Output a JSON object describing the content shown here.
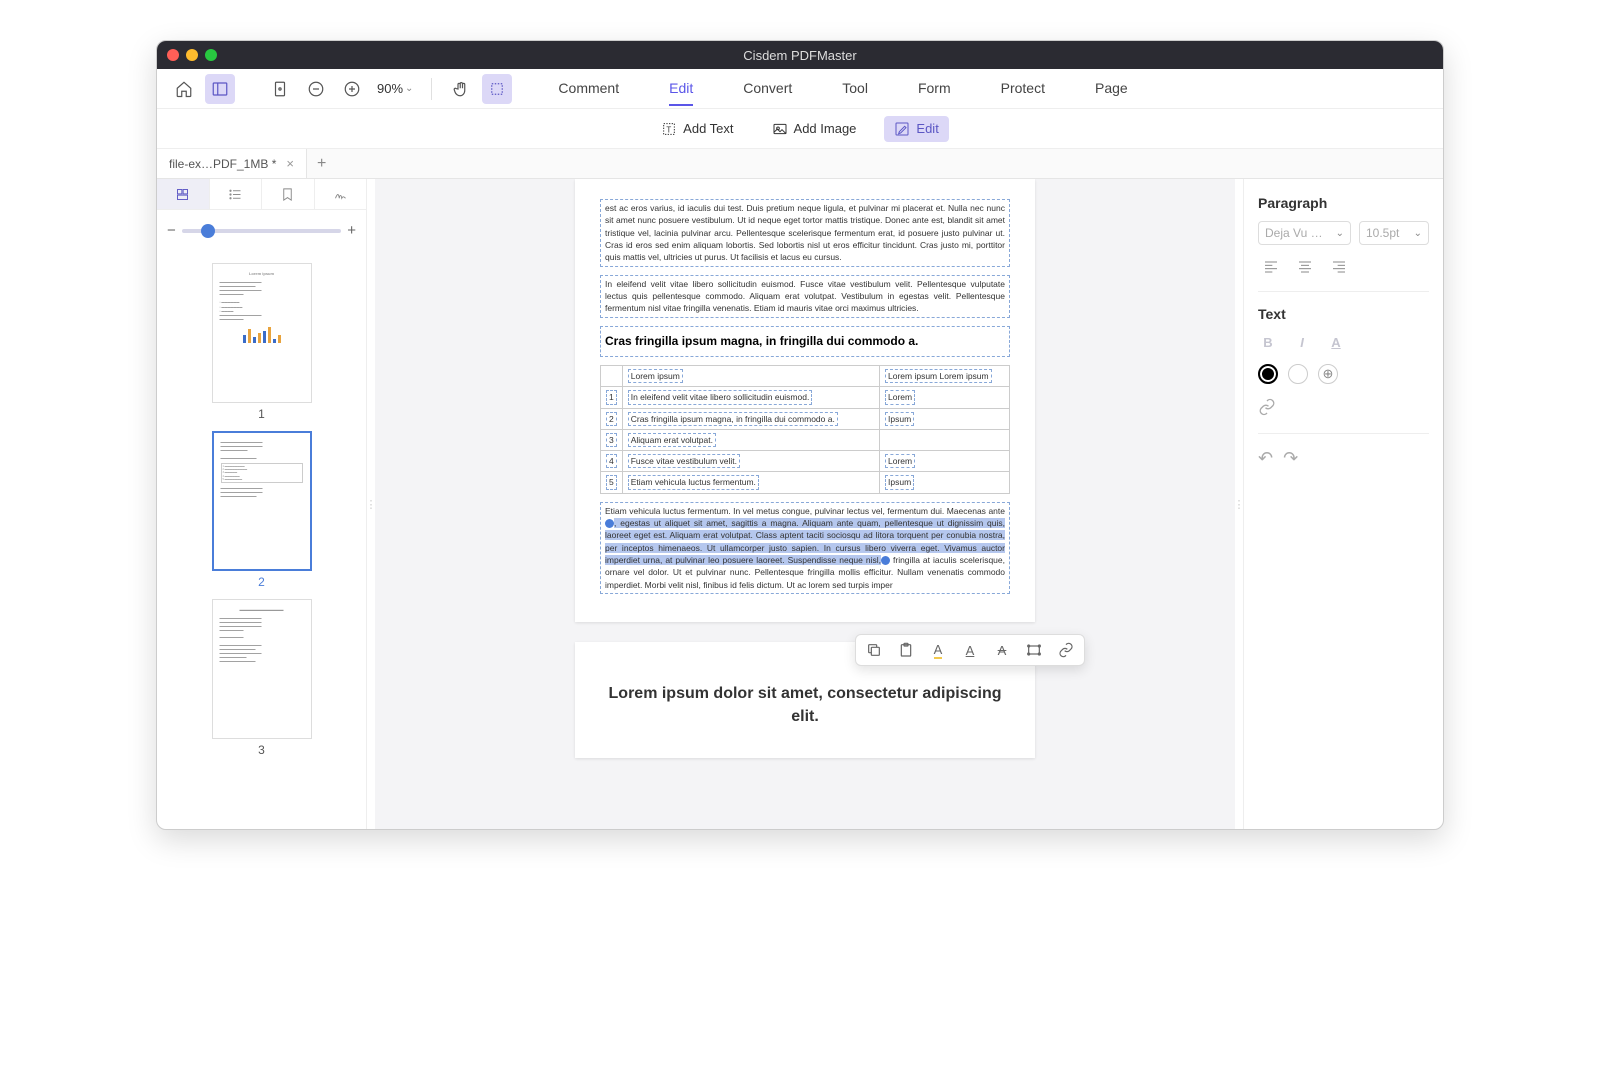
{
  "app": {
    "title": "Cisdem PDFMaster"
  },
  "toolbar": {
    "zoom": "90%",
    "menu": [
      "Comment",
      "Edit",
      "Convert",
      "Tool",
      "Form",
      "Protect",
      "Page"
    ],
    "menu_active": 1,
    "sub": {
      "add_text": "Add Text",
      "add_image": "Add Image",
      "edit": "Edit"
    }
  },
  "tab": {
    "filename": "file-ex…PDF_1MB *"
  },
  "sidebar": {
    "thumbs": [
      "1",
      "2",
      "3"
    ],
    "selected": 1
  },
  "doc": {
    "para1": "est ac eros varius, id iaculis dui test. Duis pretium neque ligula, et pulvinar mi placerat et. Nulla nec nunc sit amet nunc posuere vestibulum. Ut id neque eget tortor mattis tristique. Donec ante est, blandit sit amet tristique vel, lacinia pulvinar arcu. Pellentesque scelerisque fermentum erat, id posuere justo pulvinar ut. Cras id eros sed enim aliquam lobortis. Sed lobortis nisl ut eros efficitur tincidunt. Cras justo mi, porttitor quis mattis vel, ultricies ut purus. Ut facilisis et lacus eu cursus.",
    "para2": "In eleifend velit vitae libero sollicitudin euismod. Fusce vitae vestibulum velit. Pellentesque vulputate lectus quis pellentesque commodo. Aliquam erat volutpat. Vestibulum in egestas velit. Pellentesque fermentum nisl vitae fringilla venenatis. Etiam id mauris vitae orci maximus ultricies.",
    "heading2": "Cras fringilla ipsum magna, in fringilla dui commodo a.",
    "table": {
      "header": [
        "",
        "Lorem ipsum",
        "Lorem ipsum  Lorem ipsum"
      ],
      "rows": [
        {
          "num": "1",
          "text": "In eleifend velit vitae libero sollicitudin euismod.",
          "val": "Lorem"
        },
        {
          "num": "2",
          "text": "Cras fringilla ipsum magna, in fringilla dui commodo a.",
          "val": "Ipsum"
        },
        {
          "num": "3",
          "text": "Aliquam erat volutpat.",
          "val": ""
        },
        {
          "num": "4",
          "text": "Fusce vitae vestibulum velit.",
          "val": "Lorem"
        },
        {
          "num": "5",
          "text": "Etiam vehicula luctus fermentum.",
          "val": "Ipsum"
        }
      ]
    },
    "para3_pre": "Etiam vehicula luctus fermentum. In vel metus congue, pulvinar lectus vel, fermentum dui. Maecenas ante ",
    "para3_hl": ", egestas ut aliquet sit amet, sagittis a magna. Aliquam ante quam, pellentesque ut dignissim quis, laoreet eget est. Aliquam erat volutpat. Class aptent taciti sociosqu ad litora torquent per conubia nostra, per inceptos himenaeos. Ut ullamcorper justo sapien. In cursus libero viverra eget. Vivamus auctor imperdiet urna, at pulvinar leo posuere laoreet. Suspendisse neque nisl,",
    "para3_post": " fringilla at iaculis scelerisque, ornare vel dolor. Ut et pulvinar nunc. Pellentesque fringilla mollis efficitur. Nullam venenatis commodo imperdiet. Morbi velit nisl, finibus id felis dictum. Ut ac lorem sed turpis imper",
    "page3_title": "Lorem ipsum dolor sit amet, consectetur adipiscing elit."
  },
  "right_panel": {
    "paragraph_title": "Paragraph",
    "font": "Deja Vu …",
    "size": "10.5pt",
    "text_title": "Text",
    "bold": "B",
    "italic": "I",
    "underline_a": "A"
  }
}
